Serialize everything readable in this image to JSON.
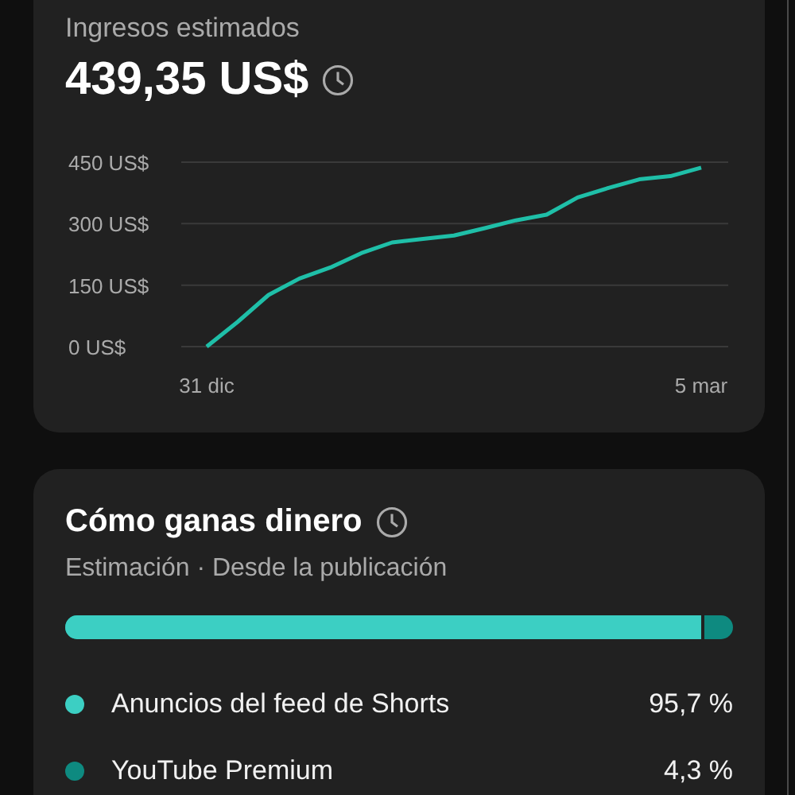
{
  "earnings": {
    "label": "Ingresos estimados",
    "amount": "439,35 US$",
    "chart_data": {
      "type": "line",
      "categories": [
        "31 dic",
        null,
        null,
        null,
        null,
        null,
        null,
        null,
        null,
        null,
        null,
        null,
        null,
        null,
        null,
        null,
        "5 mar"
      ],
      "series": [
        {
          "color": "#1fbfa8",
          "values": [
            0,
            60,
            126,
            166,
            193,
            228,
            254,
            263,
            271,
            289,
            308,
            322,
            364,
            387,
            408,
            416,
            437
          ]
        }
      ],
      "ylim": [
        0,
        450
      ],
      "yticks": [
        {
          "value": 0,
          "label": "0 US$"
        },
        {
          "value": 150,
          "label": "150 US$"
        },
        {
          "value": 300,
          "label": "300 US$"
        },
        {
          "value": 450,
          "label": "450 US$"
        }
      ]
    }
  },
  "revenue_sources": {
    "title": "Cómo ganas dinero",
    "subtitle": "Estimación · Desde la publicación",
    "sources": [
      {
        "name": "Anuncios del feed de Shorts",
        "share": "95,7 %",
        "level": 0.957,
        "color": "#3ccfc3"
      },
      {
        "name": "YouTube Premium",
        "share": "4,3 %",
        "color": "#0e8a80"
      }
    ]
  }
}
